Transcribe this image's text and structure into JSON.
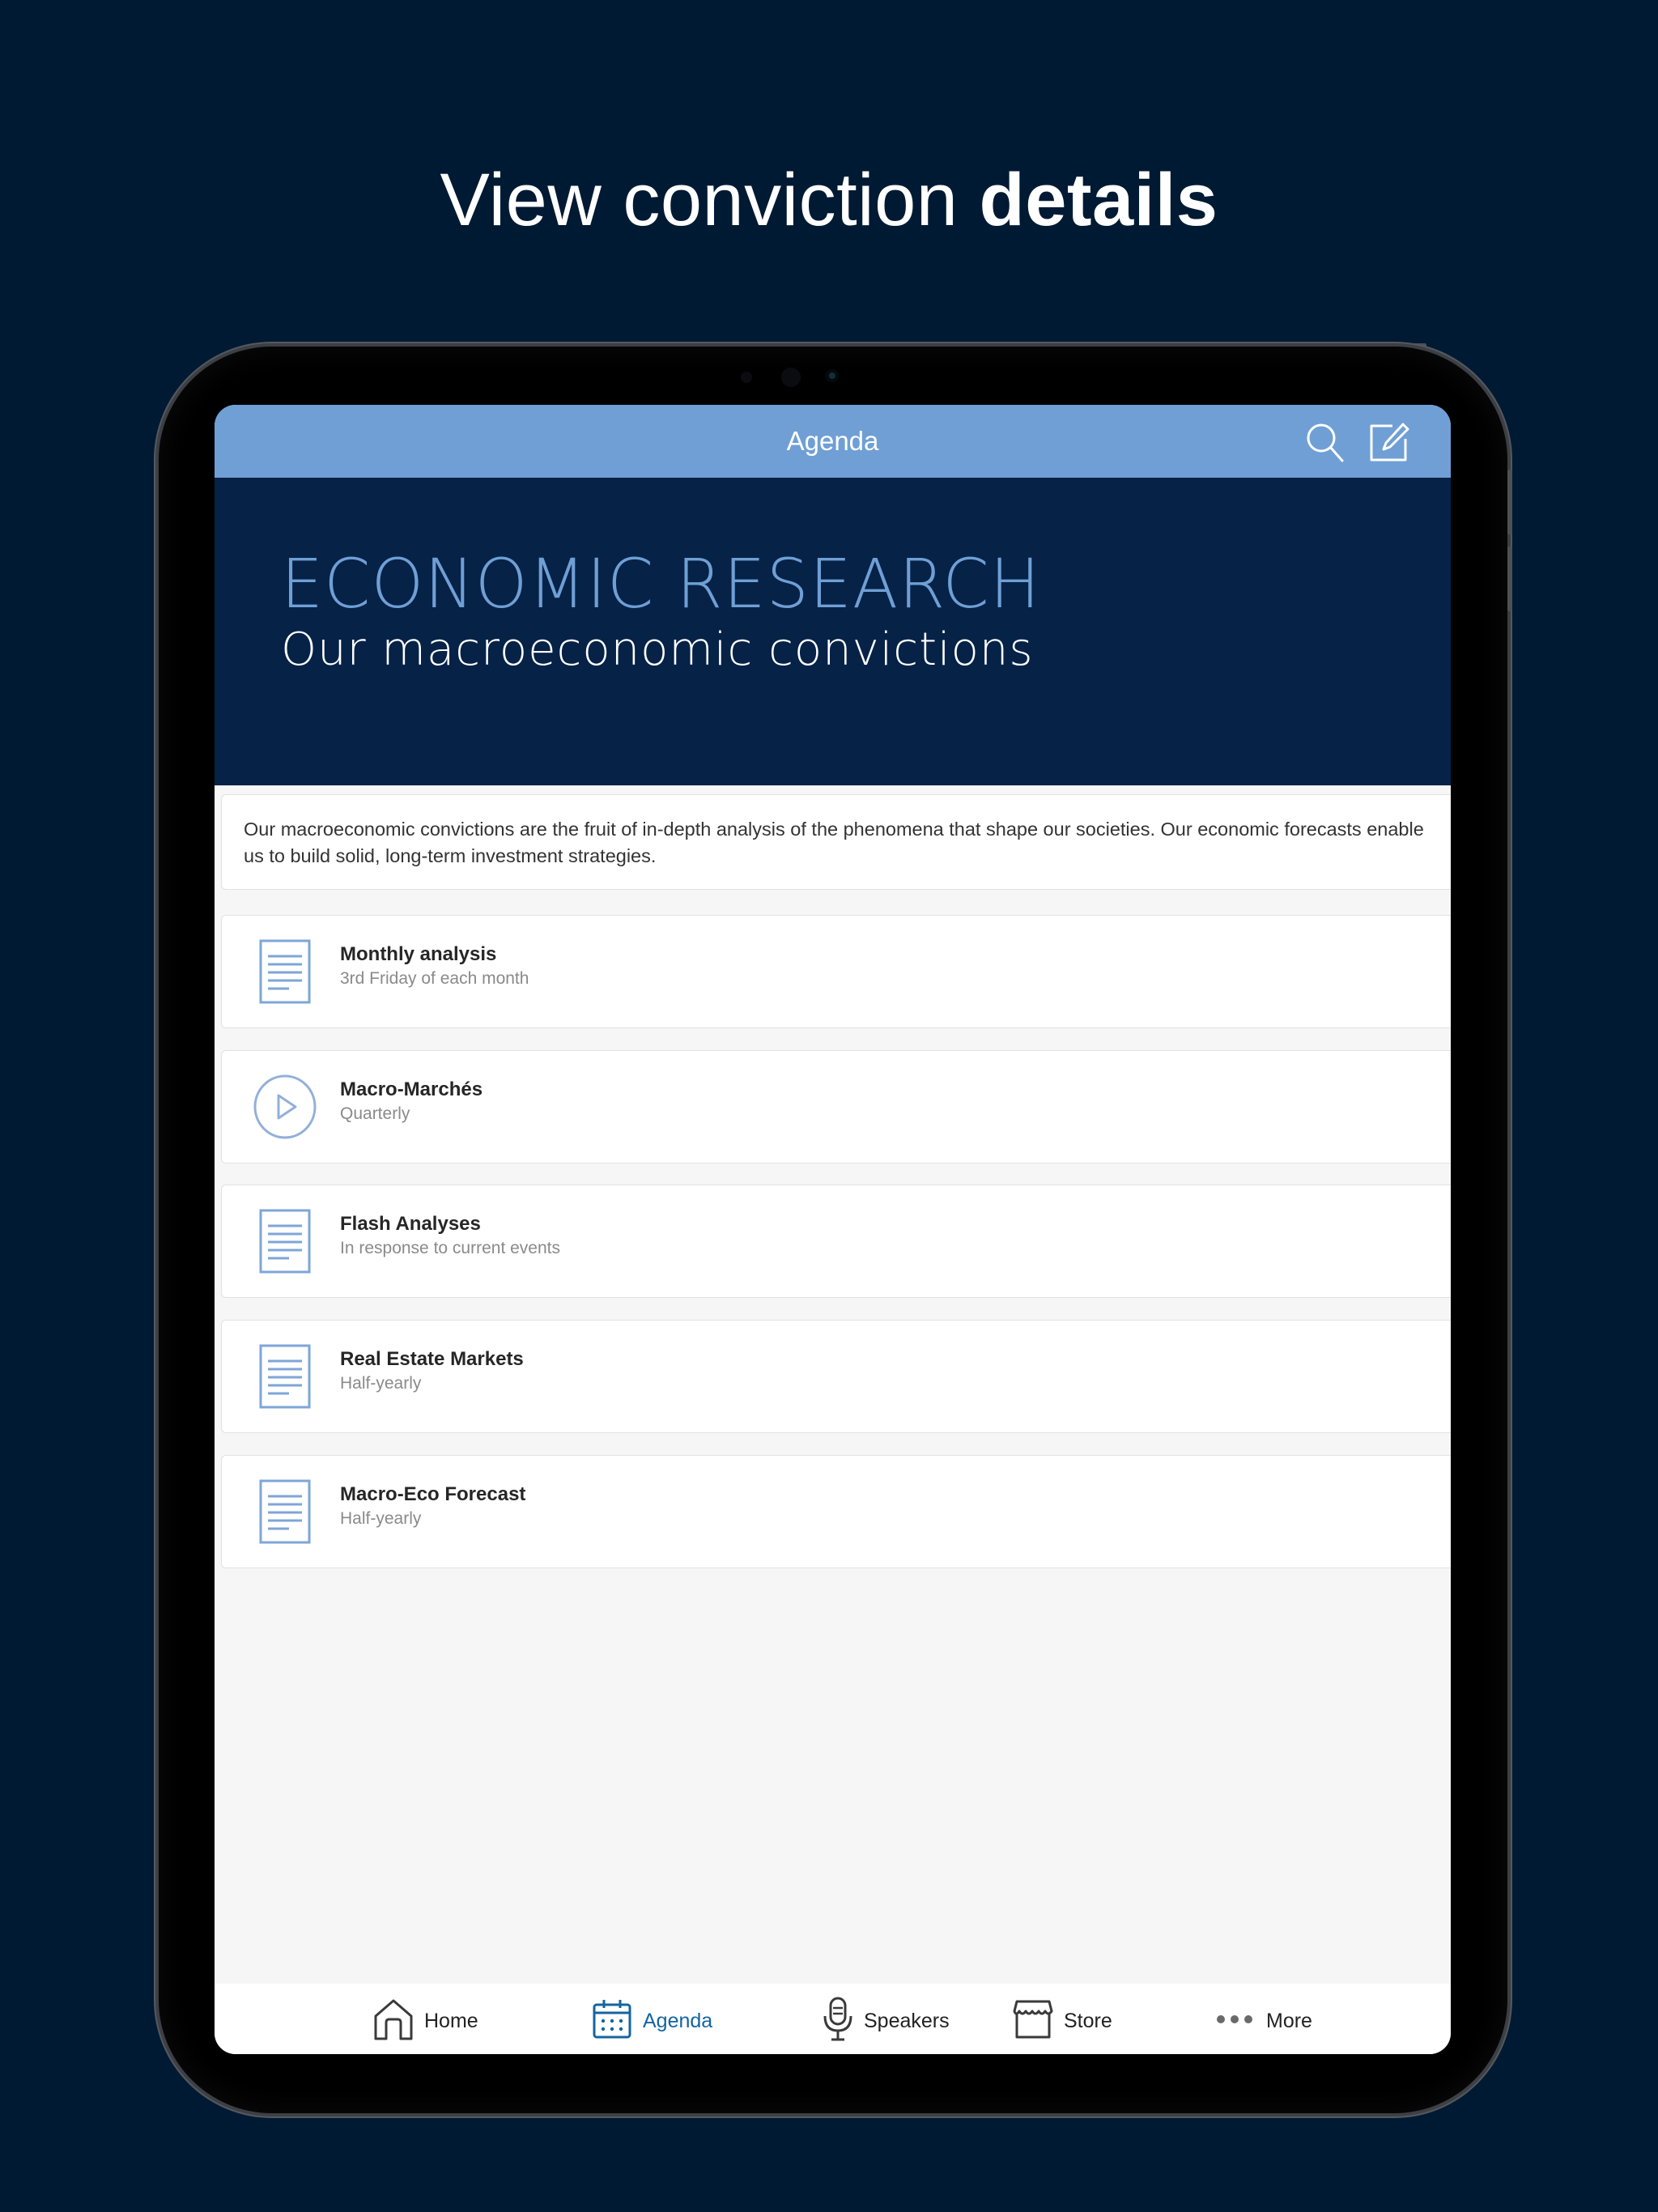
{
  "headline": {
    "regular": "View conviction ",
    "bold": "details"
  },
  "navbar": {
    "title": "Agenda",
    "icons": [
      "search-icon",
      "edit-icon"
    ]
  },
  "banner": {
    "title": "ECONOMIC RESEARCH",
    "subtitle": "Our macroeconomic convictions"
  },
  "description": "Our macroeconomic convictions are the fruit of in-depth analysis of the phenomena that shape our societies. Our economic forecasts enable us to build solid, long-term investment strategies.",
  "items": [
    {
      "title": "Monthly analysis",
      "subtitle": "3rd Friday of each month",
      "icon": "document-icon"
    },
    {
      "title": "Macro-Marchés",
      "subtitle": "Quarterly",
      "icon": "play-icon"
    },
    {
      "title": "Flash Analyses",
      "subtitle": "In response to current events",
      "icon": "document-icon"
    },
    {
      "title": "Real Estate Markets",
      "subtitle": "Half-yearly",
      "icon": "document-icon"
    },
    {
      "title": "Macro-Eco Forecast",
      "subtitle": "Half-yearly",
      "icon": "document-icon"
    }
  ],
  "tabs": [
    {
      "label": "Home",
      "icon": "home-icon",
      "active": false
    },
    {
      "label": "Agenda",
      "icon": "calendar-icon",
      "active": true
    },
    {
      "label": "Speakers",
      "icon": "microphone-icon",
      "active": false
    },
    {
      "label": "Store",
      "icon": "store-icon",
      "active": false
    },
    {
      "label": "More",
      "icon": "more-icon",
      "active": false
    }
  ],
  "colors": {
    "background": "#001a33",
    "navbar": "#6f9fd5",
    "banner": "#062247",
    "accent": "#1464a0",
    "icon_blue": "#7ea6d8"
  }
}
